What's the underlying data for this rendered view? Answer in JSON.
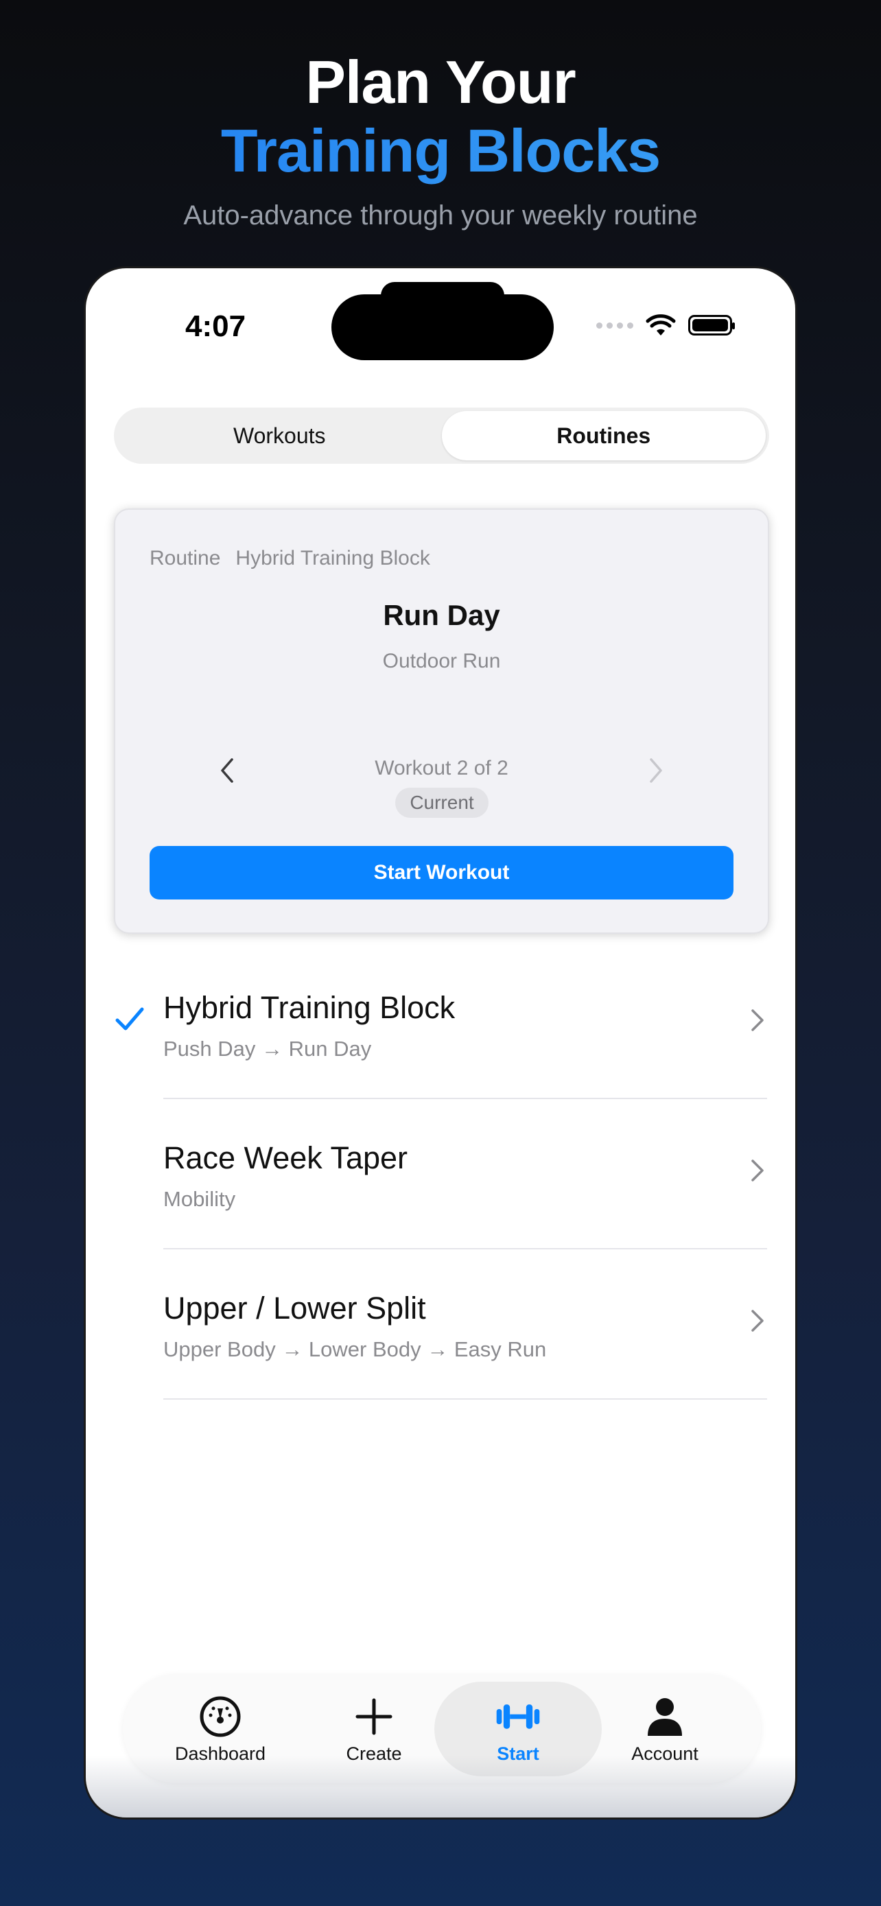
{
  "hero": {
    "line1": "Plan Your",
    "line2": "Training Blocks",
    "subtitle": "Auto-advance through your weekly routine"
  },
  "status_bar": {
    "time": "4:07"
  },
  "segmented": {
    "workouts": "Workouts",
    "routines": "Routines",
    "selected": "Routines"
  },
  "card": {
    "label": "Routine",
    "routine_name": "Hybrid Training Block",
    "title": "Run Day",
    "subtitle": "Outdoor Run",
    "pager": "Workout 2 of 2",
    "badge": "Current",
    "button": "Start Workout"
  },
  "routines": [
    {
      "title": "Hybrid Training Block",
      "subtitle": "Push Day → Run Day",
      "selected": true
    },
    {
      "title": "Race Week Taper",
      "subtitle": "Mobility",
      "selected": false
    },
    {
      "title": "Upper / Lower Split",
      "subtitle": "Upper Body → Lower Body → Easy Run",
      "selected": false
    }
  ],
  "tabbar": {
    "dashboard": "Dashboard",
    "create": "Create",
    "start": "Start",
    "account": "Account",
    "active": "Start"
  },
  "colors": {
    "accent": "#0a84ff",
    "badge_bg": "#e3e3e7",
    "card_bg": "#f2f2f6"
  }
}
